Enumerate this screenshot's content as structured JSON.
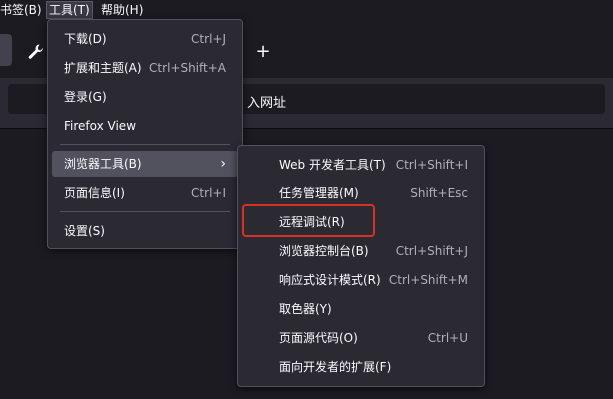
{
  "menubar": {
    "bookmarks": "书签(B)",
    "tools": "工具(T)",
    "help": "帮助(H)"
  },
  "tabstrip": {
    "newtab_symbol": "+"
  },
  "urlbar": {
    "placeholder_fragment": "入网址"
  },
  "tools_menu": {
    "items": [
      {
        "label": "下载(D)",
        "shortcut": "Ctrl+J"
      },
      {
        "label": "扩展和主题(A)",
        "shortcut": "Ctrl+Shift+A"
      },
      {
        "label": "登录(G)",
        "shortcut": ""
      },
      {
        "label": "Firefox View",
        "shortcut": ""
      },
      {
        "label": "浏览器工具(B)",
        "shortcut": "",
        "submenu_arrow": "›"
      },
      {
        "label": "页面信息(I)",
        "shortcut": "Ctrl+I"
      },
      {
        "label": "设置(S)",
        "shortcut": ""
      }
    ]
  },
  "browser_tools_submenu": {
    "items": [
      {
        "label": "Web 开发者工具(T)",
        "shortcut": "Ctrl+Shift+I"
      },
      {
        "label": "任务管理器(M)",
        "shortcut": "Shift+Esc"
      },
      {
        "label": "远程调试(R)",
        "shortcut": ""
      },
      {
        "label": "浏览器控制台(B)",
        "shortcut": "Ctrl+Shift+J"
      },
      {
        "label": "响应式设计模式(R)",
        "shortcut": "Ctrl+Shift+M"
      },
      {
        "label": "取色器(Y)",
        "shortcut": ""
      },
      {
        "label": "页面源代码(O)",
        "shortcut": "Ctrl+U"
      },
      {
        "label": "面向开发者的扩展(F)",
        "shortcut": ""
      }
    ]
  },
  "colors": {
    "highlight_border": "#d93025",
    "menu_bg": "#2b2a33",
    "hover_bg": "#52525e"
  },
  "icons": {
    "wrench": "wrench-icon",
    "new_tab": "plus-icon",
    "submenu": "chevron-right-icon"
  }
}
